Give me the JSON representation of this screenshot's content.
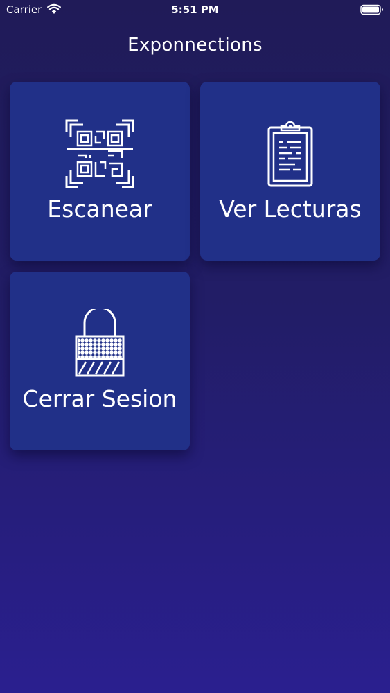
{
  "status_bar": {
    "carrier": "Carrier",
    "time": "5:51 PM"
  },
  "header": {
    "title": "Exponnections"
  },
  "menu": {
    "items": [
      {
        "label": "Escanear",
        "icon": "qr-scan-icon"
      },
      {
        "label": "Ver Lecturas",
        "icon": "clipboard-icon"
      },
      {
        "label": "Cerrar Sesion",
        "icon": "lock-icon"
      }
    ]
  },
  "colors": {
    "background_top": "#201b58",
    "background_bottom": "#2a1f8f",
    "tile": "#213088",
    "text": "#ffffff"
  }
}
